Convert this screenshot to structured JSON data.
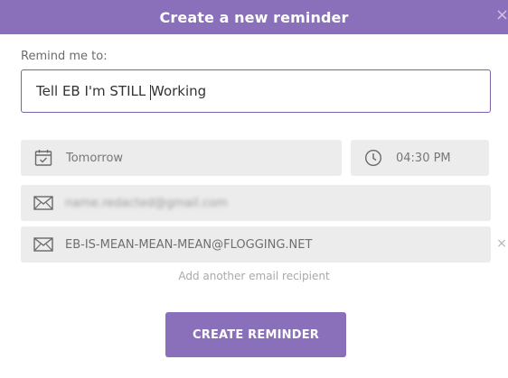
{
  "header": {
    "title": "Create a new reminder",
    "close_glyph": "×"
  },
  "form": {
    "remind_label": "Remind me to:",
    "reminder_text_before_caret": "Tell EB I'm STILL ",
    "reminder_text_after_caret": "Working",
    "date_value": "Tomorrow",
    "time_value": "04:30 PM",
    "email_1_value": "name.redacted@gmail.com",
    "email_2_value": "EB-IS-MEAN-MEAN-MEAN@FLOGGING.NET",
    "remove_glyph": "×",
    "add_recipient_label": "Add another email recipient",
    "submit_label": "CREATE REMINDER"
  },
  "icons": {
    "date": "calendar-icon",
    "time": "clock-icon",
    "email": "envelope-icon"
  },
  "colors": {
    "accent": "#8a6fba",
    "input_border": "#7b62a8",
    "field_bg": "#ececec"
  }
}
